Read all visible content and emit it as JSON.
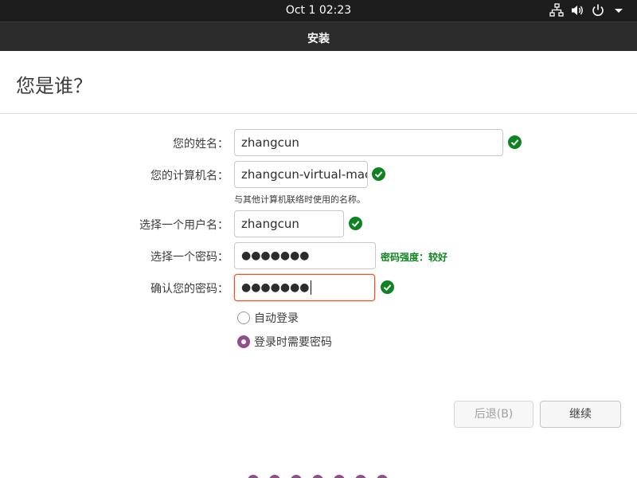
{
  "topbar": {
    "clock": "Oct 1  02:23",
    "icons": [
      "network-icon",
      "volume-icon",
      "power-icon",
      "menu-arrow-icon"
    ]
  },
  "window": {
    "title": "安装"
  },
  "page": {
    "heading": "您是谁？"
  },
  "form": {
    "name": {
      "label": "您的姓名：",
      "value": "zhangcun",
      "valid": true
    },
    "computer": {
      "label": "您的计算机名：",
      "value": "zhangcun-virtual-mach",
      "hint": "与其他计算机联络时使用的名称。",
      "valid": true
    },
    "username": {
      "label": "选择一个用户名：",
      "value": "zhangcun",
      "valid": true
    },
    "password": {
      "label": "选择一个密码：",
      "value": "●●●●●●●",
      "strength": "密码强度：较好"
    },
    "confirm": {
      "label": "确认您的密码：",
      "value": "●●●●●●●",
      "valid": true
    }
  },
  "login": {
    "auto_label": "自动登录",
    "password_label": "登录时需要密码",
    "selected": "password"
  },
  "buttons": {
    "back": "后退(B)",
    "next": "继续"
  },
  "progress": {
    "total": 7
  },
  "colors": {
    "accent": "#e95420",
    "check": "#0e8420",
    "radio": "#924d8b"
  }
}
